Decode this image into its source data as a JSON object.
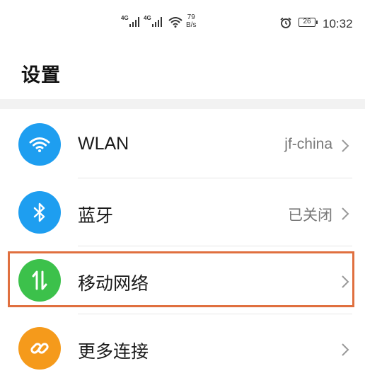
{
  "status_bar": {
    "net1": "4G",
    "net2": "4G",
    "speed_value": "79",
    "speed_unit": "B/s",
    "battery": "26",
    "time": "10:32"
  },
  "page": {
    "title": "设置"
  },
  "settings": [
    {
      "label": "WLAN",
      "value": "jf-china",
      "icon": "wifi-icon",
      "color": "#1e9ef0"
    },
    {
      "label": "蓝牙",
      "value": "已关闭",
      "icon": "bluetooth-icon",
      "color": "#1e9ef0"
    },
    {
      "label": "移动网络",
      "value": "",
      "icon": "mobile-data-icon",
      "color": "#3cc14b",
      "highlighted": true
    },
    {
      "label": "更多连接",
      "value": "",
      "icon": "link-icon",
      "color": "#f59a1b"
    }
  ],
  "colors": {
    "highlight": "#e0703f"
  }
}
